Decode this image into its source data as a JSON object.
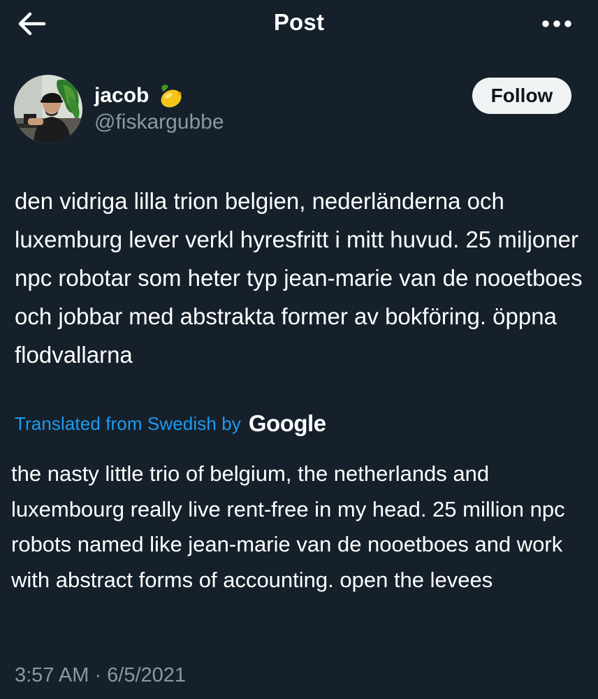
{
  "header": {
    "title": "Post",
    "back_icon": "arrow-left-icon",
    "more_icon": "more-horizontal-icon"
  },
  "author": {
    "display_name": "jacob",
    "name_emoji": "🍋",
    "handle": "@fiskargubbe",
    "follow_label": "Follow"
  },
  "post": {
    "text": "den vidriga lilla trion belgien, nederländerna och luxemburg lever verkl hyresfritt i mitt huvud. 25 miljoner npc robotar som heter typ jean-marie van de nooetboes och jobbar med abstrakta former av bokföring. öppna flodvallarna",
    "translated_label": "Translated from Swedish by",
    "translation_provider": "Google",
    "translation": "the nasty little trio of belgium, the netherlands and luxembourg really live rent-free in my head. 25 million npc robots named like jean-marie van de nooetboes and work with abstract forms of accounting. open the levees",
    "timestamp": "3:57 AM · 6/5/2021"
  },
  "colors": {
    "background": "#15202b",
    "text": "#ffffff",
    "secondary": "#8b98a5",
    "link": "#1d9bf0",
    "follow_bg": "#eff3f4"
  }
}
